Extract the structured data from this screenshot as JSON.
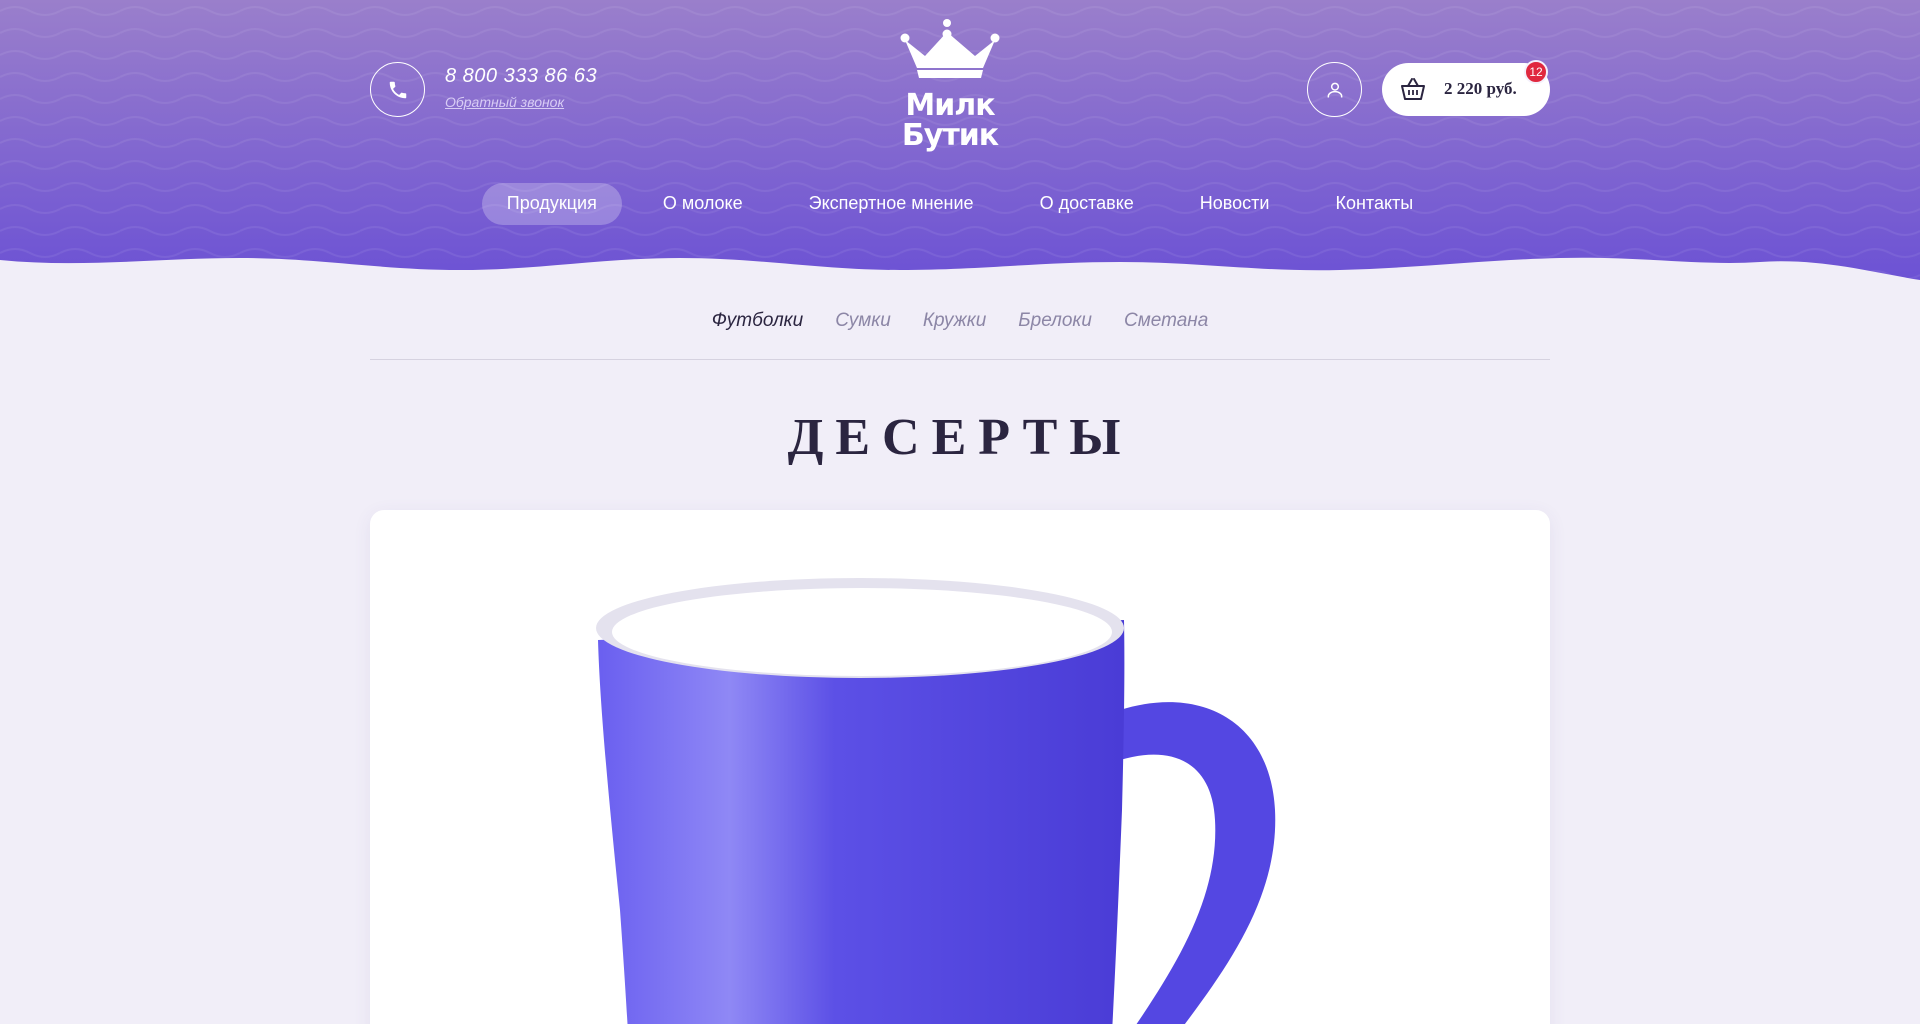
{
  "header": {
    "phone": "8 800 333 86 63",
    "callback_label": "Обратный звонок",
    "logo_line1": "Милк",
    "logo_line2": "Бутик"
  },
  "cart": {
    "total": "2 220 руб.",
    "badge_count": "12"
  },
  "nav": {
    "items": [
      {
        "label": "Продукция"
      },
      {
        "label": "О молоке"
      },
      {
        "label": "Экспертное мнение"
      },
      {
        "label": "О доставке"
      },
      {
        "label": "Новости"
      },
      {
        "label": "Контакты"
      }
    ],
    "active_index": 0
  },
  "subnav": {
    "items": [
      {
        "label": "Футболки"
      },
      {
        "label": "Сумки"
      },
      {
        "label": "Кружки"
      },
      {
        "label": "Брелоки"
      },
      {
        "label": "Сметана"
      }
    ],
    "active_index": 0
  },
  "page": {
    "title": "ДЕСЕРТЫ"
  },
  "colors": {
    "header_top": "#9a7fcb",
    "header_bottom": "#7459d3",
    "page_bg": "#f1eef8",
    "mug": "#5b4ee6",
    "badge": "#e0283e"
  },
  "icons": {
    "phone": "phone-icon",
    "user": "user-icon",
    "cart": "basket-icon",
    "logo": "crown-icon"
  }
}
